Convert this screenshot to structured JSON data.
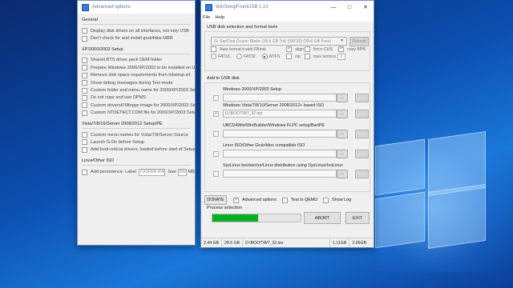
{
  "advanced_window": {
    "title": "Advanced options",
    "sections": [
      {
        "title": "General",
        "options": [
          {
            "label": "Display disk drives on all interfaces, not only USB",
            "checked": false
          },
          {
            "label": "Don't check for and install grub4dos MBR",
            "checked": false
          }
        ]
      },
      {
        "title": "XP/2000/2003 Setup",
        "options": [
          {
            "label": "Shared BTS driver pack OEM folder",
            "checked": false
          },
          {
            "label": "Prepare Windows 2000/XP/2003 to be installed on USB",
            "checked": false
          },
          {
            "label": "Remove disk space requirements from txtsetup.sif",
            "checked": false
          },
          {
            "label": "Show debug messages during Text mode",
            "checked": false
          },
          {
            "label": "Custom folder and menu name for 2000/XP/2003 Setup",
            "checked": false
          },
          {
            "label": "Do not copy and use DPMS",
            "checked": false
          },
          {
            "label": "Custom drivers/F6floppy image for 2000/XP/2003 Setup",
            "checked": false
          },
          {
            "label": "Custom NTDETECT.COM file for 2000/XP/2003 Setup",
            "checked": false
          }
        ]
      },
      {
        "title": "Vista/7/8/10/Server 2008/2012 Setup/PE",
        "options": [
          {
            "label": "Custom menu names for Vista/7/8/Server Source",
            "checked": false
          },
          {
            "label": "Launch G-Dir before Setup",
            "checked": false
          },
          {
            "label": "Add boot-critical drivers, loaded before start of Setup",
            "checked": false
          }
        ]
      },
      {
        "title": "Linux/Other ISO",
        "options": []
      }
    ],
    "persistence": {
      "check_label": "Add persistence",
      "label_text": "Label",
      "label_value": "CASPER-RW",
      "size_text": "Size",
      "size_value": "300",
      "unit": "MB"
    }
  },
  "main_window": {
    "title": "WinSetupFromUSB 1.10",
    "menu": [
      "File",
      "Help"
    ],
    "usb_group": {
      "title": "USB disk selection and format tools",
      "disk_value": "G: SanDisk Cruzer Blade (28.6 GB Tot) (FAT32) (28.6 GB Free)",
      "refresh_label": "Refresh",
      "auto_format_label": "Auto format it with FBinst",
      "fs_options": [
        {
          "label": "FAT16",
          "selected": false
        },
        {
          "label": "FAT32",
          "selected": false
        },
        {
          "label": "NTFS",
          "selected": true
        }
      ],
      "align_label": "align",
      "force_chs_label": "force CHS",
      "copy_bpb_label": "copy BPB",
      "zip_label": "zip",
      "max_sectors_label": "max sectors",
      "max_sectors_value": "1"
    },
    "add_group": {
      "title": "Add to USB disk",
      "sources": [
        {
          "label": "Windows 2000/XP/2003 Setup",
          "path": "",
          "checked": false,
          "browse": "..."
        },
        {
          "label": "Windows Vista/7/8/10/Server 2008/2012+ based ISO",
          "path": "G:\\BOOT\\W7_32.iso",
          "checked": true,
          "browse": "..."
        },
        {
          "label": "UBCD4Win/WinBuilder/Windows FLPC setup/BartPE",
          "path": "",
          "checked": false,
          "browse": "..."
        },
        {
          "label": "Linux ISO/Other Grub4dos compatible ISO",
          "path": "",
          "checked": false,
          "browse": "..."
        },
        {
          "label": "SysLinux bootsector/Linux distribution using SysLinux/IsoLinux",
          "path": "",
          "checked": false,
          "browse": "..."
        }
      ]
    },
    "bottom": {
      "donate_label": "DONATE",
      "advanced_label": "Advanced options",
      "advanced_checked": true,
      "qemu_label": "Test in QEMU",
      "qemu_checked": false,
      "log_label": "Show Log",
      "log_checked": false
    },
    "process": {
      "title": "Process selection",
      "progress_fraction": 0.52,
      "abort_label": "ABORT",
      "exit_label": "EXIT"
    },
    "status": {
      "used": "2.44 GB",
      "total": "28.6 GB",
      "current_file": "D:\\BOOT\\W7_32.iso",
      "file_size": "1.11GB",
      "remaining": "2.05GB"
    },
    "colors": {
      "progress": "#06b025"
    }
  }
}
